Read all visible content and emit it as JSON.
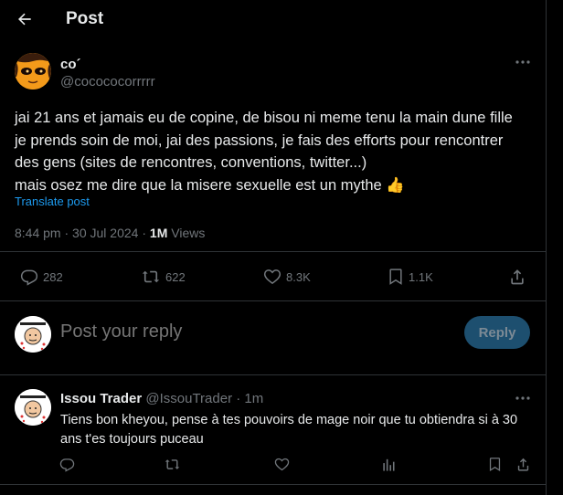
{
  "header": {
    "title": "Post",
    "back_icon": "arrow-left-icon"
  },
  "tweet": {
    "author_name": "co´",
    "author_handle": "@cocococorrrrr",
    "text_lines": [
      "jai 21 ans et jamais eu de copine, de bisou ni meme tenu la main dune fille",
      "je prends soin de moi, jai des passions, je fais des efforts pour rencontrer",
      "des gens (sites de rencontres, conventions, twitter...)",
      "mais osez me dire que la misere sexuelle est un mythe"
    ],
    "emoji": "👍",
    "translate_label": "Translate post",
    "time": "8:44 pm",
    "separator": "·",
    "date": "30 Jul 2024",
    "views_count": "1M",
    "views_label": "Views",
    "stats": {
      "replies": "282",
      "reposts": "622",
      "likes": "8.3K",
      "bookmarks": "1.1K"
    }
  },
  "composer": {
    "placeholder": "Post your reply",
    "reply_button": "Reply"
  },
  "reply": {
    "author_name": "Issou Trader",
    "author_handle": "@IssouTrader",
    "separator": "·",
    "time": "1m",
    "text_lines": [
      "Tiens bon kheyou, pense à tes pouvoirs de mage noir que tu obtiendra si à 30",
      "ans t'es toujours puceau"
    ]
  },
  "colors": {
    "background": "#000000",
    "text": "#e7e9ea",
    "muted": "#71767b",
    "accent": "#1d9bf0",
    "divider": "#2f3336",
    "reply_button_bg": "#1d4f6f"
  }
}
